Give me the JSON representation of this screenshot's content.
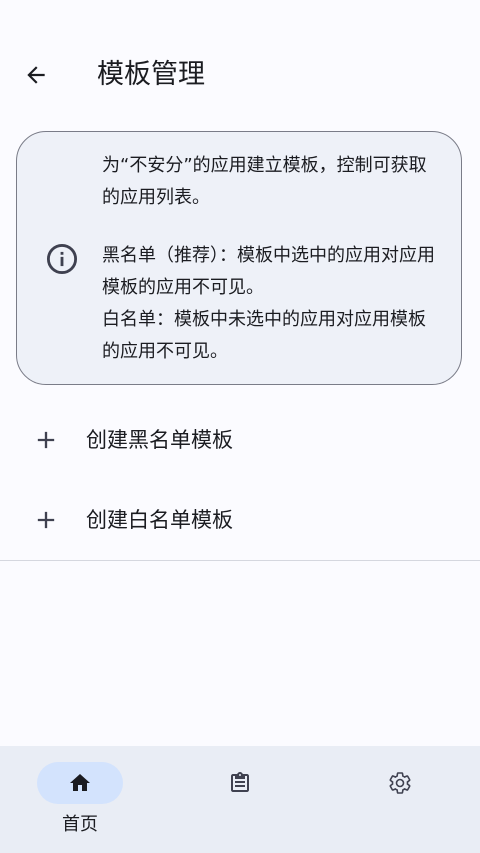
{
  "header": {
    "title": "模板管理",
    "back_icon": "arrow-left-icon"
  },
  "info_card": {
    "icon": "info-icon",
    "line1": "为“不安分”的应用建立模板，控制可获取的应用列表。",
    "blacklist_desc": "黑名单（推荐）：模板中选中的应用对应用模板的应用不可见。",
    "whitelist_desc": "白名单：模板中未选中的应用对应用模板的应用不可见。"
  },
  "actions": [
    {
      "label": "创建黑名单模板",
      "icon": "plus-icon"
    },
    {
      "label": "创建白名单模板",
      "icon": "plus-icon"
    }
  ],
  "bottom_nav": {
    "items": [
      {
        "label": "首页",
        "icon": "home-icon",
        "selected": true
      },
      {
        "label": "",
        "icon": "clipboard-icon",
        "selected": false
      },
      {
        "label": "",
        "icon": "gear-icon",
        "selected": false
      }
    ]
  },
  "colors": {
    "background": "#fbfbff",
    "card_bg": "#eef1f8",
    "nav_bg": "#e9edf5",
    "nav_selected_pill": "#d3e3fd",
    "text": "#1b1c21"
  }
}
